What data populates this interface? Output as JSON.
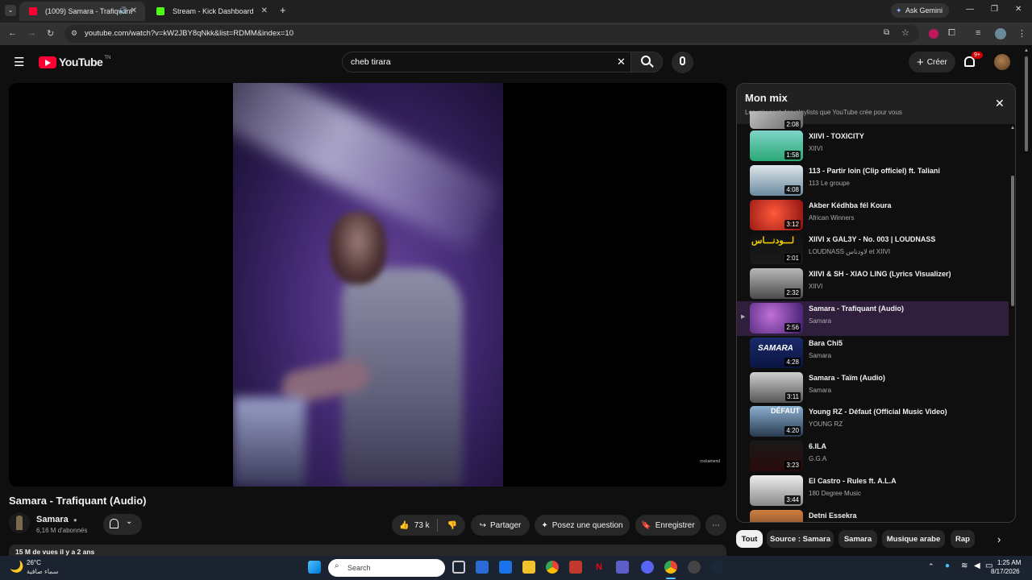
{
  "browser": {
    "tabs": [
      {
        "title": "(1009) Samara - Trafiquant",
        "active": true
      },
      {
        "title": "Stream - Kick Dashboard",
        "active": false
      }
    ],
    "url": "youtube.com/watch?v=kW2JBY8qNkk&list=RDMM&index=10",
    "ask_gemini": "Ask Gemini"
  },
  "header": {
    "logo_text": "YouTube",
    "logo_region": "TN",
    "search_value": "cheb tirara",
    "create_label": "Créer",
    "notif_badge": "9+"
  },
  "video": {
    "watermark": "rockamend",
    "title": "Samara - Trafiquant (Audio)",
    "channel": "Samara",
    "subscribers": "6,16 M d'abonnés",
    "likes": "73 k",
    "share": "Partager",
    "ask": "Posez une question",
    "save": "Enregistrer",
    "views": "15 M de vues  il y a 2 ans"
  },
  "playlist": {
    "title": "Mon mix",
    "subtitle": "Les mix sont des playlists que YouTube crée pour vous",
    "partial_top_duration": "2:08",
    "items": [
      {
        "title": "XIIVI - TOXICITY",
        "channel": "XIIVI",
        "duration": "1:58"
      },
      {
        "title": "113 - Partir loin (Clip officiel) ft. Taliani",
        "channel": "113 Le groupe",
        "duration": "4:08"
      },
      {
        "title": "Akber Kédhba fél Koura",
        "channel": "African Winners",
        "duration": "3:12"
      },
      {
        "title": "XIIVI x GAL3Y - No. 003 | LOUDNASS",
        "channel": "LOUDNASS لاودناس et XIIVI",
        "duration": "2:01"
      },
      {
        "title": "XIIVI & SH - XIAO LING (Lyrics Visualizer)",
        "channel": "XIIVI",
        "duration": "2:32"
      },
      {
        "title": "Samara - Trafiquant (Audio)",
        "channel": "Samara",
        "duration": "2:56",
        "active": true
      },
      {
        "title": "Bara Chi5",
        "channel": "Samara",
        "duration": "4:28"
      },
      {
        "title": "Samara - Taïm (Audio)",
        "channel": "Samara",
        "duration": "3:11"
      },
      {
        "title": "Young RZ - Défaut (Official Music Video)",
        "channel": "YOUNG RZ",
        "duration": "4:20"
      },
      {
        "title": "6.ILA",
        "channel": "G.G.A",
        "duration": "3:23"
      },
      {
        "title": "El Castro - Rules ft. A.L.A",
        "channel": "180 Degree Music",
        "duration": "3:44"
      },
      {
        "title": "Detni Essekra",
        "channel": "",
        "duration": ""
      }
    ],
    "thumb_labels": {
      "loudnass": "لـــودنـــاس",
      "samara": "SAMARA",
      "defaut": "DÉFAUT"
    }
  },
  "chips": [
    "Tout",
    "Source : Samara",
    "Samara",
    "Musique arabe",
    "Rap"
  ],
  "taskbar": {
    "weather_temp": "26°C",
    "weather_desc": "سماء صافية",
    "search": "Search",
    "time": "1:25 AM",
    "date": "8/17/2026"
  },
  "colors": {
    "accent_red": "#ff0033",
    "active_row": "#2f1e3c"
  }
}
